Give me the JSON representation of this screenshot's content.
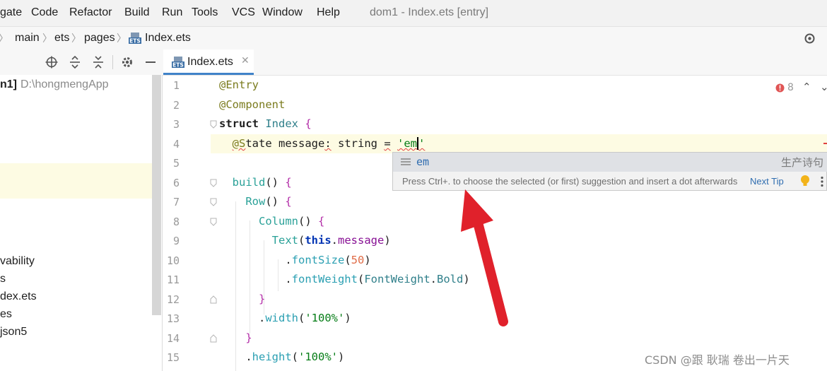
{
  "menubar": {
    "items": [
      "gate",
      "Code",
      "Refactor",
      "Build",
      "Run",
      "Tools",
      "VCS",
      "Window",
      "Help"
    ],
    "window_title": "dom1 - Index.ets [entry]"
  },
  "breadcrumb": {
    "items": [
      "main",
      "ets",
      "pages",
      "Index.ets"
    ],
    "file_badge": "ETS"
  },
  "project_panel": {
    "root_label": "n1]",
    "root_path": "D:\\hongmengApp",
    "items": [
      "vability",
      "s",
      "dex.ets",
      "es",
      "json5"
    ]
  },
  "editor_tab": {
    "label": "Index.ets",
    "badge": "ETS"
  },
  "inspection": {
    "count": "8"
  },
  "code": {
    "line_numbers": [
      "1",
      "2",
      "3",
      "4",
      "5",
      "6",
      "7",
      "8",
      "9",
      "10",
      "11",
      "12",
      "13",
      "14",
      "15"
    ]
  },
  "completion": {
    "suggestion": "em",
    "source": "生产诗句",
    "hint": "Press Ctrl+. to choose the selected (or first) suggestion and insert a dot afterwards",
    "next_tip": "Next Tip"
  },
  "watermark": "CSDN @跟 耿瑞 卷出一片天",
  "colors": {
    "accent": "#4083c9",
    "current_line": "#fdfbe3",
    "annotation": "#7b7c1f",
    "arrow": "#e0212b"
  }
}
